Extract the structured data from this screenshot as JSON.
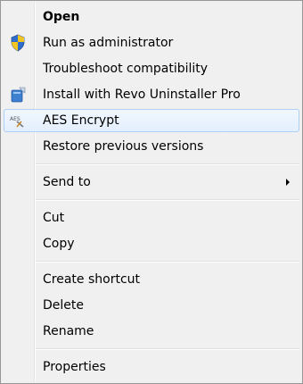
{
  "menu": {
    "items": [
      {
        "label": "Open",
        "icon": null
      },
      {
        "label": "Run as administrator",
        "icon": "uac-shield-icon"
      },
      {
        "label": "Troubleshoot compatibility",
        "icon": null
      },
      {
        "label": "Install with Revo Uninstaller Pro",
        "icon": "revo-uninstaller-icon"
      },
      {
        "label": "AES Encrypt",
        "icon": "aes-encrypt-icon"
      },
      {
        "label": "Restore previous versions",
        "icon": null
      },
      {
        "label": "Send to",
        "icon": "submenu-arrow"
      },
      {
        "label": "Cut",
        "icon": null
      },
      {
        "label": "Copy",
        "icon": null
      },
      {
        "label": "Create shortcut",
        "icon": null
      },
      {
        "label": "Delete",
        "icon": null
      },
      {
        "label": "Rename",
        "icon": null
      },
      {
        "label": "Properties",
        "icon": null
      }
    ],
    "aes_icon_text": "AES",
    "hovered_item": "AES Encrypt"
  },
  "colors": {
    "menu_background": "#f0f0f0",
    "menu_border": "#979797",
    "hover_border": "#aecff7",
    "hover_fill": "#e3effd",
    "shield_blue": "#2f6ecb",
    "shield_yellow": "#f3c522"
  }
}
